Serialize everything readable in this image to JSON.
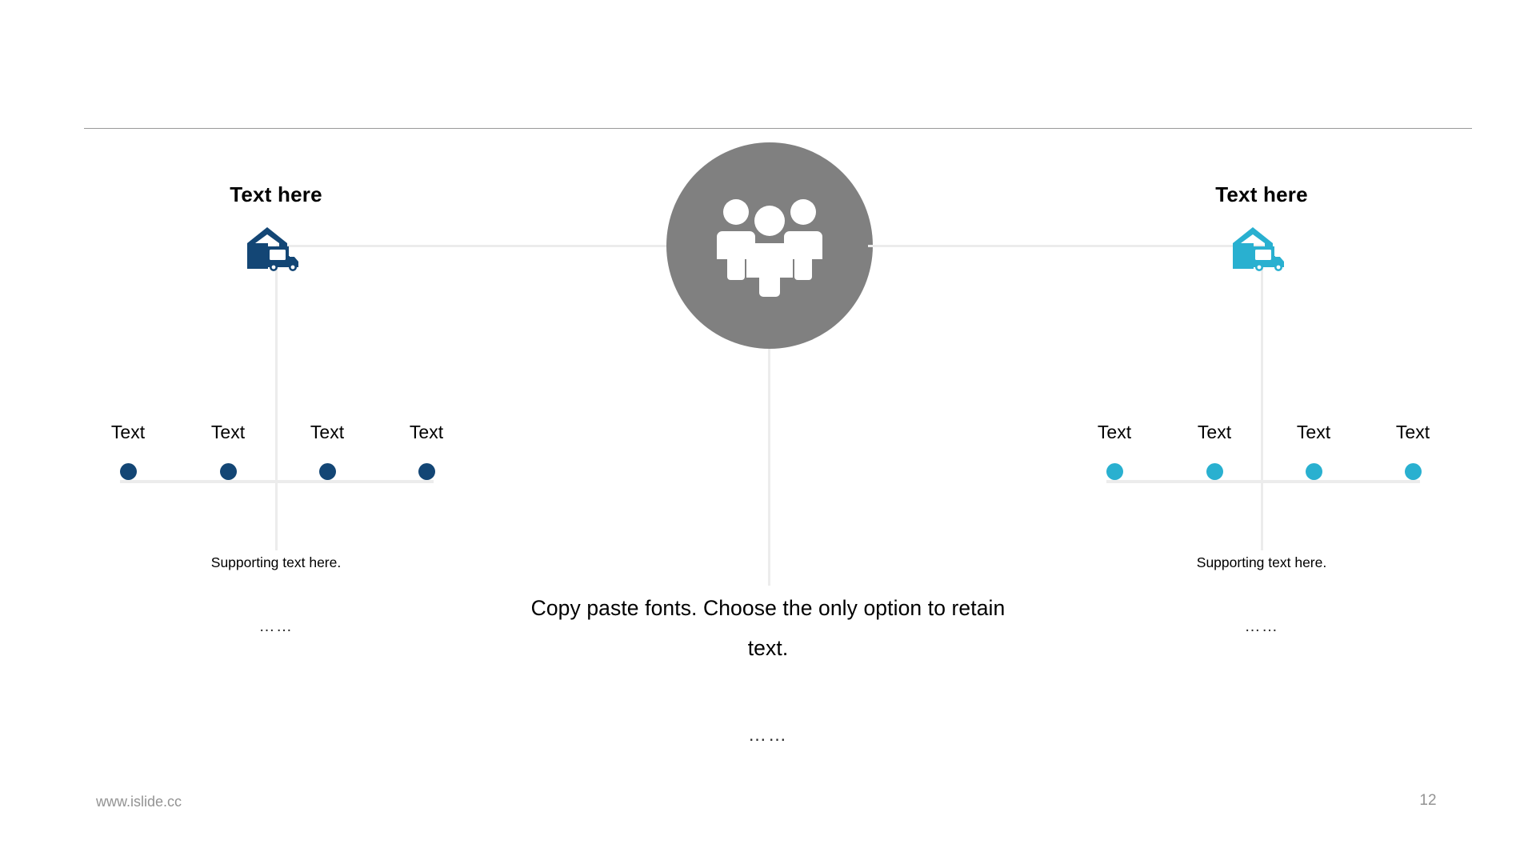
{
  "slide": {
    "page_number": "12",
    "footer_url": "www.islide.cc",
    "colors": {
      "left_accent": "#134675",
      "right_accent": "#29b0d0",
      "center_circle": "#808080",
      "connector_line": "#ececec",
      "divider": "#9a9a9a",
      "footer_text": "#939393"
    }
  },
  "center": {
    "icon": "people-group-icon",
    "body_text": "Copy paste fonts. Choose the only option to retain text.",
    "ellipsis": "……"
  },
  "left": {
    "title": "Text here",
    "icon": "warehouse-truck-icon",
    "supporting_text": "Supporting text here.",
    "ellipsis": "……",
    "dots": [
      {
        "label": "Text"
      },
      {
        "label": "Text"
      },
      {
        "label": "Text"
      },
      {
        "label": "Text"
      }
    ]
  },
  "right": {
    "title": "Text here",
    "icon": "warehouse-truck-icon",
    "supporting_text": "Supporting text here.",
    "ellipsis": "……",
    "dots": [
      {
        "label": "Text"
      },
      {
        "label": "Text"
      },
      {
        "label": "Text"
      },
      {
        "label": "Text"
      }
    ]
  }
}
